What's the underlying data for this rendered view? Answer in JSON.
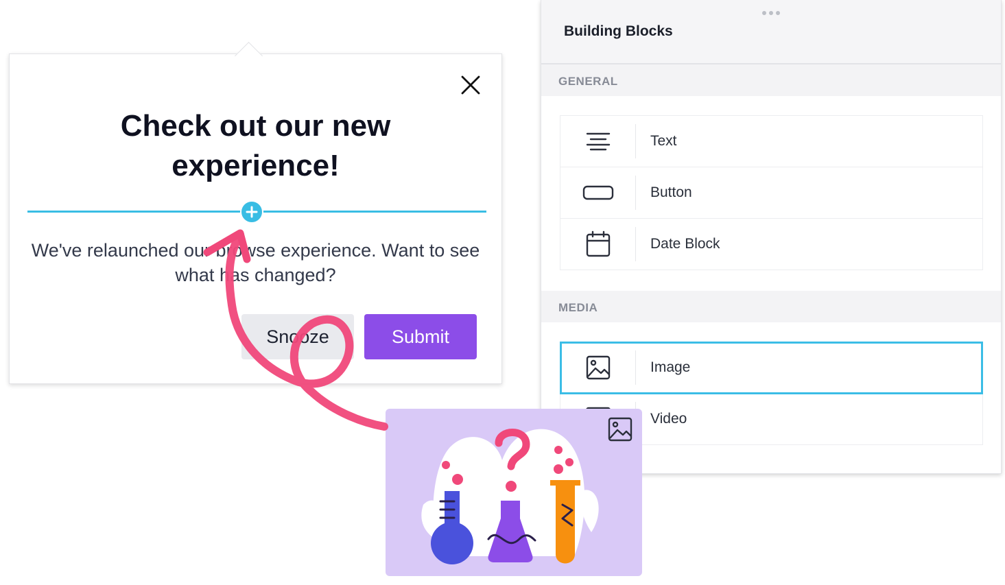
{
  "panel": {
    "title": "Building Blocks",
    "sections": [
      {
        "label": "GENERAL",
        "items": [
          {
            "label": "Text",
            "icon": "text-align-icon"
          },
          {
            "label": "Button",
            "icon": "button-icon"
          },
          {
            "label": "Date Block",
            "icon": "calendar-icon"
          }
        ]
      },
      {
        "label": "MEDIA",
        "items": [
          {
            "label": "Image",
            "icon": "image-icon",
            "selected": true
          },
          {
            "label": "Video",
            "icon": "video-icon"
          }
        ]
      }
    ]
  },
  "modal": {
    "title": "Check out our new experience!",
    "body": "We've relaunched our browse experience. Want to see what has changed?",
    "snooze_label": "Snooze",
    "submit_label": "Submit"
  },
  "colors": {
    "accent": "#39bde4",
    "submit": "#8c4de8",
    "arrow": "#f0487a",
    "preview_bg": "#d9c9f7"
  }
}
